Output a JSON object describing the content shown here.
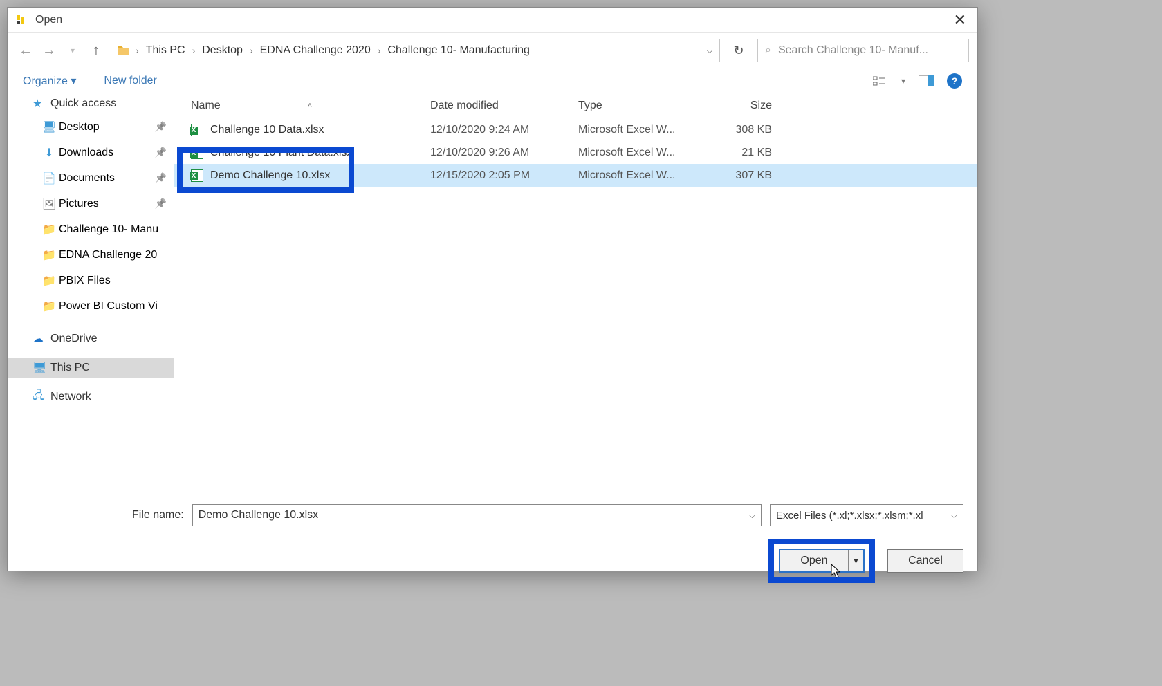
{
  "title": "Open",
  "breadcrumb": [
    "This PC",
    "Desktop",
    "EDNA Challenge 2020",
    "Challenge 10- Manufacturing"
  ],
  "search_placeholder": "Search Challenge 10- Manuf...",
  "toolbar": {
    "organize": "Organize",
    "new_folder": "New folder"
  },
  "sidebar": {
    "quick_access": "Quick access",
    "items": [
      {
        "label": "Desktop",
        "icon": "desktop"
      },
      {
        "label": "Downloads",
        "icon": "download"
      },
      {
        "label": "Documents",
        "icon": "doc"
      },
      {
        "label": "Pictures",
        "icon": "pic"
      },
      {
        "label": "Challenge 10- Manu",
        "icon": "folder"
      },
      {
        "label": "EDNA Challenge 20",
        "icon": "folder"
      },
      {
        "label": "PBIX Files",
        "icon": "folder"
      },
      {
        "label": "Power BI Custom Vi",
        "icon": "folder"
      }
    ],
    "onedrive": "OneDrive",
    "this_pc": "This PC",
    "network": "Network"
  },
  "columns": {
    "name": "Name",
    "date": "Date modified",
    "type": "Type",
    "size": "Size"
  },
  "files": [
    {
      "name": "Challenge 10 Data.xlsx",
      "date": "12/10/2020 9:24 AM",
      "type": "Microsoft Excel W...",
      "size": "308 KB"
    },
    {
      "name": "Challenge 10 Plant Data.xlsx",
      "date": "12/10/2020 9:26 AM",
      "type": "Microsoft Excel W...",
      "size": "21 KB"
    },
    {
      "name": "Demo Challenge 10.xlsx",
      "date": "12/15/2020 2:05 PM",
      "type": "Microsoft Excel W...",
      "size": "307 KB"
    }
  ],
  "file_name_label": "File name:",
  "file_name_value": "Demo Challenge 10.xlsx",
  "filter_text": "Excel Files (*.xl;*.xlsx;*.xlsm;*.xl",
  "buttons": {
    "open": "Open",
    "cancel": "Cancel"
  },
  "help_label": "?"
}
